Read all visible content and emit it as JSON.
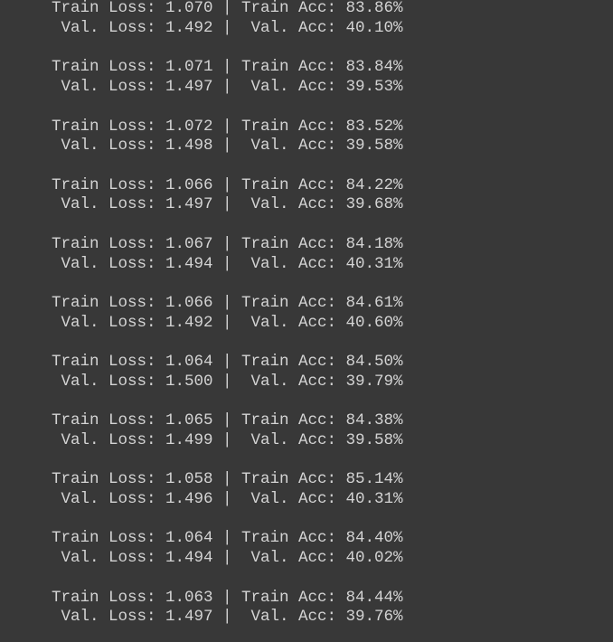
{
  "log": {
    "lines": [
      "Train Loss: 1.070 | Train Acc: 83.86%",
      " Val. Loss: 1.492 |  Val. Acc: 40.10%",
      "Train Loss: 1.071 | Train Acc: 83.84%",
      " Val. Loss: 1.497 |  Val. Acc: 39.53%",
      "Train Loss: 1.072 | Train Acc: 83.52%",
      " Val. Loss: 1.498 |  Val. Acc: 39.58%",
      "Train Loss: 1.066 | Train Acc: 84.22%",
      " Val. Loss: 1.497 |  Val. Acc: 39.68%",
      "Train Loss: 1.067 | Train Acc: 84.18%",
      " Val. Loss: 1.494 |  Val. Acc: 40.31%",
      "Train Loss: 1.066 | Train Acc: 84.61%",
      " Val. Loss: 1.492 |  Val. Acc: 40.60%",
      "Train Loss: 1.064 | Train Acc: 84.50%",
      " Val. Loss: 1.500 |  Val. Acc: 39.79%",
      "Train Loss: 1.065 | Train Acc: 84.38%",
      " Val. Loss: 1.499 |  Val. Acc: 39.58%",
      "Train Loss: 1.058 | Train Acc: 85.14%",
      " Val. Loss: 1.496 |  Val. Acc: 40.31%",
      "Train Loss: 1.064 | Train Acc: 84.40%",
      " Val. Loss: 1.494 |  Val. Acc: 40.02%",
      "Train Loss: 1.063 | Train Acc: 84.44%",
      " Val. Loss: 1.497 |  Val. Acc: 39.76%"
    ]
  },
  "colors": {
    "background": "#383838",
    "text": "#d4d4d4"
  }
}
